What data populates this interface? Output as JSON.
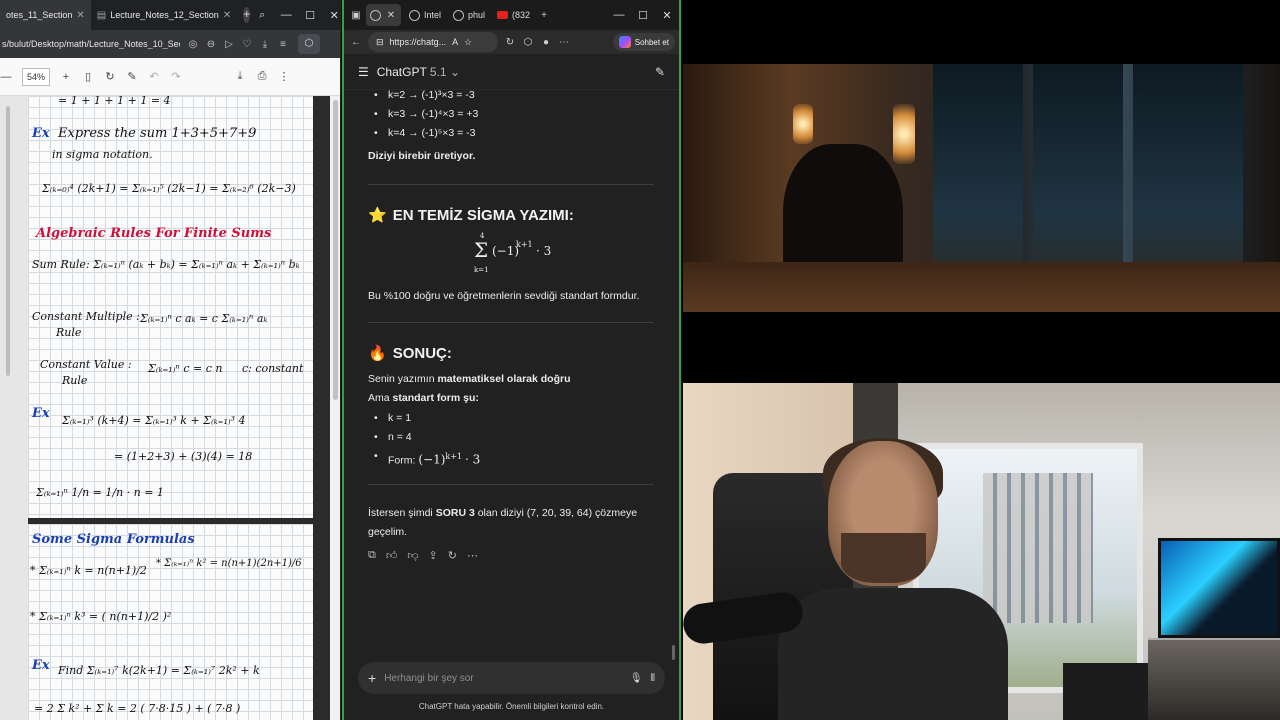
{
  "pdf_browser": {
    "tabs": [
      {
        "label": "otes_11_Section",
        "active": true
      },
      {
        "label": "Lecture_Notes_12_Section",
        "active": false
      }
    ],
    "url": "s/bulut/Desktop/math/Lecture_Notes_10_Secti",
    "zoom": "54%",
    "notes": {
      "line_top": "= 1 + 1 + 1 + 1 = 4",
      "ex1_label": "Ex",
      "ex1_line1": "Express the sum 1+3+5+7+9",
      "ex1_line2": "in sigma notation.",
      "ex1_math": "Σ₍ₖ₌₀₎⁴ (2k+1) = Σ₍ₖ₌₁₎⁵ (2k−1) = Σ₍ₖ₌₂₎⁶ (2k−3)",
      "rules_title": "Algebraic Rules For Finite Sums",
      "sum_rule": "Sum Rule:  Σ₍ₖ₌₁₎ⁿ (aₖ + bₖ) = Σ₍ₖ₌₁₎ⁿ aₖ + Σ₍ₖ₌₁₎ⁿ bₖ",
      "const_mult_label": "Constant Multiple :",
      "const_mult_rule": "Rule",
      "const_mult_math": "Σ₍ₖ₌₁₎ⁿ c aₖ = c Σ₍ₖ₌₁₎ⁿ aₖ",
      "const_value_label": "Constant Value :",
      "const_value_rule": "Rule",
      "const_value_math": "Σ₍ₖ₌₁₎ⁿ c = c n",
      "const_value_note": "c: constant",
      "ex2_label": "Ex",
      "ex2_math": "Σ₍ₖ₌₁₎³ (k+4) = Σ₍ₖ₌₁₎³ k + Σ₍ₖ₌₁₎³ 4",
      "ex2_result": "= (1+2+3) + (3)(4) = 18",
      "ex3_math": "Σ₍ₖ₌₁₎ⁿ 1/n = 1/n · n = 1",
      "formulas_title": "Some Sigma Formulas",
      "f1": "* Σ₍ₖ₌₁₎ⁿ k = n(n+1)/2",
      "f2": "* Σ₍ₖ₌₁₎ⁿ k² = n(n+1)(2n+1)/6",
      "f3": "* Σ₍ₖ₌₁₎ⁿ k³ = ( n(n+1)/2 )²",
      "ex4_label": "Ex",
      "ex4_math": "Find Σ₍ₖ₌₁₎⁷ k(2k+1) = Σ₍ₖ₌₁₎⁷ 2k² + k",
      "ex4_next": "= 2 Σ k² + Σ k = 2 ( 7·8·15 ) + ( 7·8 )"
    }
  },
  "chat_browser": {
    "tabs": [
      {
        "label": "Intel"
      },
      {
        "label": "phul"
      },
      {
        "label": "(832"
      }
    ],
    "url": "https://chatg...",
    "copilot_label": "Sohbet et",
    "model_name": "ChatGPT",
    "model_version": "5.1",
    "bullets_top": [
      "k=2 → (-1)³×3 = -3",
      "k=3 → (-1)⁴×3 = +3",
      "k=4 → (-1)⁵×3 = -3"
    ],
    "line_bold1": "Diziyi birebir üretiyor.",
    "h_sigma_emoji": "⭐",
    "h_sigma": "EN TEMİZ SİGMA YAZIMI:",
    "formula_top": "4",
    "formula_sum": "Σ",
    "formula_bottom": "k=1",
    "formula_body": "(−1)",
    "formula_exp": "k+1",
    "formula_tail": "· 3",
    "para_sigma": "Bu %100 doğru ve öğretmenlerin sevdiği standart formdur.",
    "h_result_emoji": "🔥",
    "h_result": "SONUÇ:",
    "result_line1_pre": "Senin yazımın ",
    "result_line1_bold": "matematiksel olarak doğru",
    "result_line2_pre": "Ama ",
    "result_line2_bold": "standart form şu:",
    "bullets_result": [
      "k = 1",
      "n = 4"
    ],
    "form_label": "Form: ",
    "form_body": "(−1)",
    "form_exp": "k+1",
    "form_tail": "· 3",
    "closing_pre": "İstersen şimdi ",
    "closing_bold": "SORU 3",
    "closing_post": " olan diziyi (7, 20, 39, 64) çözmeye geçelim.",
    "composer_placeholder": "Herhangi bir şey sor",
    "disclaimer": "ChatGPT hata yapabilir. Önemli bilgileri kontrol edin."
  },
  "colors": {
    "chat_bg": "#212121",
    "window_accent": "#2fa34a",
    "note_blue": "#1a3fb0",
    "note_red": "#d0103a"
  }
}
